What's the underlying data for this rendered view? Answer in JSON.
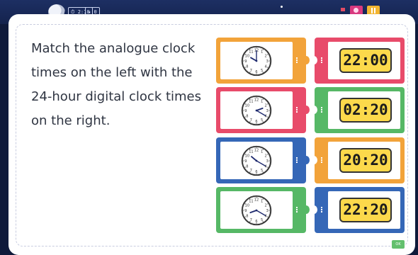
{
  "topbar": {
    "chip_timer": "2:10",
    "chip_score": "0"
  },
  "question": "Match the analogue clock times on the left with the 24-hour digital clock times on the right.",
  "left_tiles": [
    {
      "color": "#f2a33a",
      "clock": {
        "hour": 10,
        "minute": 0
      }
    },
    {
      "color": "#e84b6a",
      "clock": {
        "hour": 2,
        "minute": 20
      }
    },
    {
      "color": "#3567b7",
      "clock": {
        "hour": 10,
        "minute": 20
      }
    },
    {
      "color": "#56b866",
      "clock": {
        "hour": 8,
        "minute": 20
      }
    }
  ],
  "right_tiles": [
    {
      "color": "#e84b6a",
      "time": "22:00"
    },
    {
      "color": "#56b866",
      "time": "02:20"
    },
    {
      "color": "#f2a33a",
      "time": "20:20"
    },
    {
      "color": "#3567b7",
      "time": "22:20"
    }
  ],
  "submit_label": "OK"
}
